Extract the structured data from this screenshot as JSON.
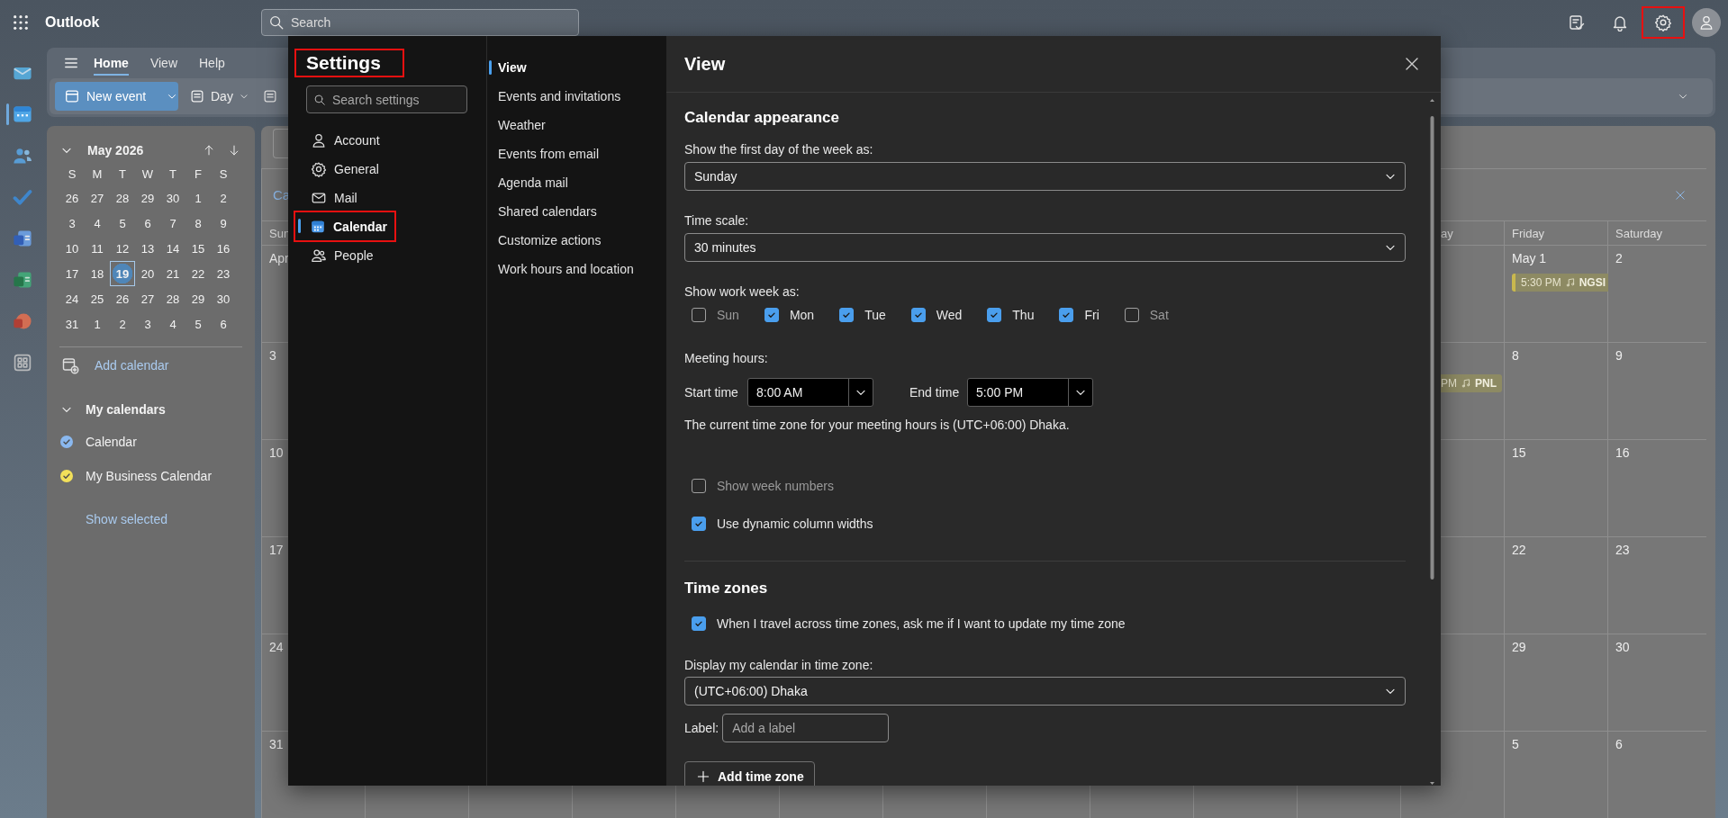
{
  "top_bar": {
    "app_name": "Outlook",
    "search_placeholder": "Search",
    "settings_highlighted": true
  },
  "app_rail": [
    {
      "kind": "mail",
      "selected": false
    },
    {
      "kind": "calendar",
      "selected": true
    },
    {
      "kind": "people",
      "selected": false
    },
    {
      "kind": "todo",
      "selected": false
    },
    {
      "kind": "word",
      "selected": false
    },
    {
      "kind": "excel",
      "selected": false
    },
    {
      "kind": "powerpoint",
      "selected": false
    },
    {
      "kind": "apps",
      "selected": false
    }
  ],
  "ribbon": {
    "tabs": [
      {
        "label": "Home",
        "selected": true
      },
      {
        "label": "View",
        "selected": false
      },
      {
        "label": "Help",
        "selected": false
      }
    ],
    "new_event": "New event",
    "view_button": "Day"
  },
  "mini_calendar": {
    "title": "May 2026",
    "weekdays": [
      "S",
      "M",
      "T",
      "W",
      "T",
      "F",
      "S"
    ],
    "days": [
      {
        "label": "26",
        "selected": false
      },
      {
        "label": "27",
        "selected": false
      },
      {
        "label": "28",
        "selected": false
      },
      {
        "label": "29",
        "selected": false
      },
      {
        "label": "30",
        "selected": false
      },
      {
        "label": "1",
        "selected": false
      },
      {
        "label": "2",
        "selected": false
      },
      {
        "label": "3",
        "selected": false
      },
      {
        "label": "4",
        "selected": false
      },
      {
        "label": "5",
        "selected": false
      },
      {
        "label": "6",
        "selected": false
      },
      {
        "label": "7",
        "selected": false
      },
      {
        "label": "8",
        "selected": false
      },
      {
        "label": "9",
        "selected": false
      },
      {
        "label": "10",
        "selected": false
      },
      {
        "label": "11",
        "selected": false
      },
      {
        "label": "12",
        "selected": false
      },
      {
        "label": "13",
        "selected": false
      },
      {
        "label": "14",
        "selected": false
      },
      {
        "label": "15",
        "selected": false
      },
      {
        "label": "16",
        "selected": false
      },
      {
        "label": "17",
        "selected": false
      },
      {
        "label": "18",
        "selected": false
      },
      {
        "label": "19",
        "selected": true
      },
      {
        "label": "20",
        "selected": false
      },
      {
        "label": "21",
        "selected": false
      },
      {
        "label": "22",
        "selected": false
      },
      {
        "label": "23",
        "selected": false
      },
      {
        "label": "24",
        "selected": false
      },
      {
        "label": "25",
        "selected": false
      },
      {
        "label": "26",
        "selected": false
      },
      {
        "label": "27",
        "selected": false
      },
      {
        "label": "28",
        "selected": false
      },
      {
        "label": "29",
        "selected": false
      },
      {
        "label": "30",
        "selected": false
      },
      {
        "label": "31",
        "selected": false
      },
      {
        "label": "1",
        "selected": false
      },
      {
        "label": "2",
        "selected": false
      },
      {
        "label": "3",
        "selected": false
      },
      {
        "label": "4",
        "selected": false
      },
      {
        "label": "5",
        "selected": false
      },
      {
        "label": "6",
        "selected": false
      }
    ]
  },
  "add_calendar": "Add calendar",
  "my_calendars": {
    "title": "My calendars",
    "items": [
      {
        "label": "Calendar",
        "color": "#8ab8ef",
        "checked": true
      },
      {
        "label": "My Business Calendar",
        "color": "#f2e05a",
        "checked": true
      }
    ]
  },
  "show_selected": "Show selected",
  "calendar_view": {
    "link": "Ca",
    "headers": {
      "sun": "Sun",
      "thu": "ay",
      "fri": "Friday",
      "sat": "Saturday"
    },
    "weeks": [
      {
        "sun": {
          "date": "Apr"
        },
        "fri": {
          "date": "May 1",
          "events": [
            {
              "time": "5:30 PM",
              "title": "NGSI"
            }
          ]
        },
        "sat": {
          "date": "2"
        }
      },
      {
        "sun": {
          "date": "3"
        },
        "thu": {
          "events": [
            {
              "time": "PM",
              "title": "PNL"
            }
          ]
        },
        "fri": {
          "date": "8"
        },
        "sat": {
          "date": "9"
        }
      },
      {
        "sun": {
          "date": "10"
        },
        "fri": {
          "date": "15"
        },
        "sat": {
          "date": "16"
        }
      },
      {
        "sun": {
          "date": "17"
        },
        "fri": {
          "date": "22"
        },
        "sat": {
          "date": "23"
        }
      },
      {
        "sun": {
          "date": "24"
        },
        "fri": {
          "date": "29"
        },
        "sat": {
          "date": "30"
        }
      },
      {
        "sun": {
          "date": "31"
        },
        "fri": {
          "date": "5"
        },
        "sat": {
          "date": "6"
        }
      }
    ]
  },
  "settings": {
    "title": "Settings",
    "title_highlighted": true,
    "search_placeholder": "Search settings",
    "categories": [
      {
        "kind": "account",
        "label": "Account",
        "selected": false,
        "highlighted": false
      },
      {
        "kind": "general",
        "label": "General",
        "selected": false,
        "highlighted": false
      },
      {
        "kind": "mail",
        "label": "Mail",
        "selected": false,
        "highlighted": false
      },
      {
        "kind": "calendar",
        "label": "Calendar",
        "selected": true,
        "highlighted": true
      },
      {
        "kind": "people",
        "label": "People",
        "selected": false,
        "highlighted": false
      }
    ],
    "subcategories": [
      {
        "label": "View",
        "selected": true
      },
      {
        "label": "Events and invitations",
        "selected": false
      },
      {
        "label": "Weather",
        "selected": false
      },
      {
        "label": "Events from email",
        "selected": false
      },
      {
        "label": "Agenda mail",
        "selected": false
      },
      {
        "label": "Shared calendars",
        "selected": false
      },
      {
        "label": "Customize actions",
        "selected": false
      },
      {
        "label": "Work hours and location",
        "selected": false
      }
    ],
    "panel": {
      "title": "View",
      "appearance": {
        "heading": "Calendar appearance",
        "first_day": {
          "label": "Show the first day of the week as:",
          "value": "Sunday"
        },
        "time_scale": {
          "label": "Time scale:",
          "value": "30 minutes"
        },
        "work_week": {
          "label": "Show work week as:",
          "days": [
            {
              "label": "Sun",
              "checked": false
            },
            {
              "label": "Mon",
              "checked": true
            },
            {
              "label": "Tue",
              "checked": true
            },
            {
              "label": "Wed",
              "checked": true
            },
            {
              "label": "Thu",
              "checked": true
            },
            {
              "label": "Fri",
              "checked": true
            },
            {
              "label": "Sat",
              "checked": false
            }
          ]
        },
        "meeting_hours": {
          "label": "Meeting hours:",
          "start_label": "Start time",
          "start_value": "8:00 AM",
          "end_label": "End time",
          "end_value": "5:00 PM",
          "note": "The current time zone for your meeting hours is (UTC+06:00) Dhaka."
        },
        "options": [
          {
            "label": "Show week numbers",
            "checked": false
          },
          {
            "label": "Use dynamic column widths",
            "checked": true
          }
        ]
      },
      "time_zones": {
        "heading": "Time zones",
        "travel_prompt": {
          "label": "When I travel across time zones, ask me if I want to update my time zone",
          "checked": true
        },
        "display": {
          "label": "Display my calendar in time zone:",
          "value": "(UTC+06:00) Dhaka"
        },
        "zone_label": {
          "label": "Label:",
          "placeholder": "Add a label"
        },
        "add_button": "Add time zone"
      }
    }
  }
}
